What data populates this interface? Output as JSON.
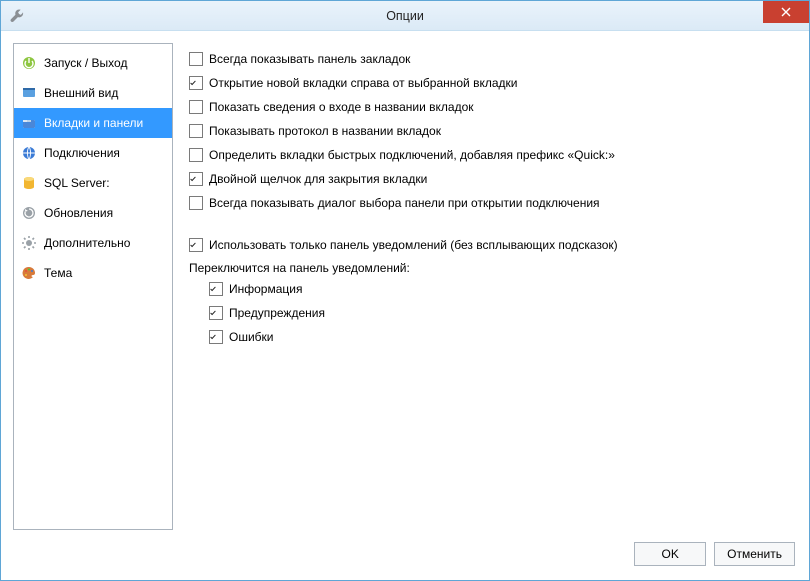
{
  "window": {
    "title": "Опции"
  },
  "sidebar": {
    "items": [
      {
        "label": "Запуск / Выход",
        "icon": "launch-exit-icon"
      },
      {
        "label": "Внешний вид",
        "icon": "appearance-icon"
      },
      {
        "label": "Вкладки и панели",
        "icon": "tabs-panels-icon",
        "selected": true
      },
      {
        "label": "Подключения",
        "icon": "connections-icon"
      },
      {
        "label": "SQL Server:",
        "icon": "sqlserver-icon"
      },
      {
        "label": "Обновления",
        "icon": "updates-icon"
      },
      {
        "label": "Дополнительно",
        "icon": "advanced-icon"
      },
      {
        "label": "Тема",
        "icon": "theme-icon"
      }
    ]
  },
  "options": {
    "cb0": {
      "label": "Всегда показывать панель закладок",
      "checked": false
    },
    "cb1": {
      "label": "Открытие новой вкладки справа от выбранной вкладки",
      "checked": true
    },
    "cb2": {
      "label": "Показать сведения о входе в названии вкладок",
      "checked": false
    },
    "cb3": {
      "label": "Показывать протокол в названии вкладок",
      "checked": false
    },
    "cb4": {
      "label": "Определить вкладки быстрых подключений, добавляя префикс «Quick:»",
      "checked": false
    },
    "cb5": {
      "label": "Двойной щелчок для закрытия  вкладки",
      "checked": true
    },
    "cb6": {
      "label": "Всегда показывать диалог выбора панели при открытии подключения",
      "checked": false
    },
    "cb7": {
      "label": "Использовать только панель уведомлений (без всплывающих подсказок)",
      "checked": true
    },
    "switch_label": "Переключится на панель уведомлений:",
    "cb8": {
      "label": "Информация",
      "checked": true
    },
    "cb9": {
      "label": "Предупреждения",
      "checked": true
    },
    "cb10": {
      "label": "Ошибки",
      "checked": true
    }
  },
  "buttons": {
    "ok": "OK",
    "cancel": "Отменить"
  }
}
